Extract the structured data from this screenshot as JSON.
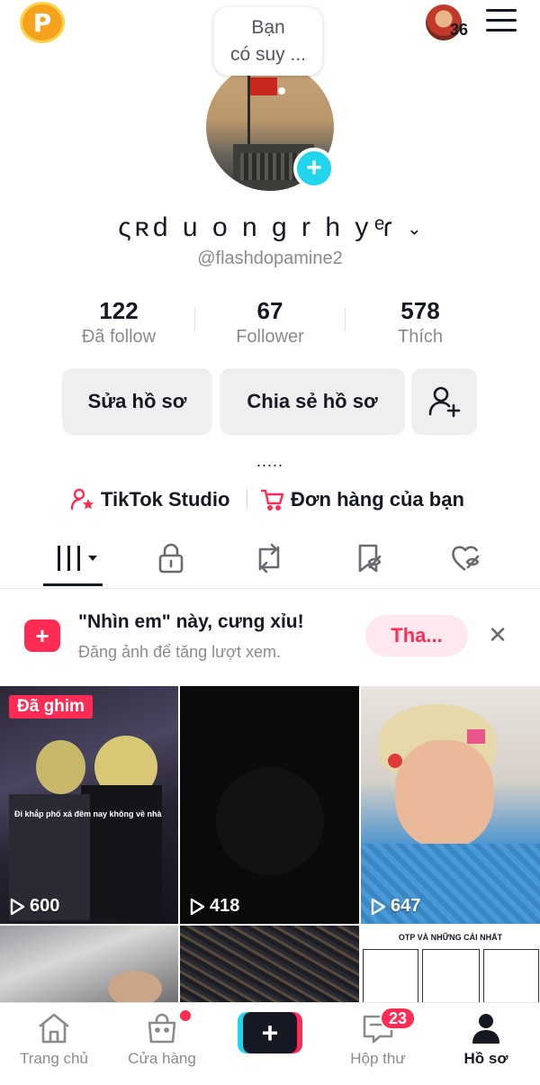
{
  "top_bar": {
    "points_badge": "P",
    "friend_count": "36"
  },
  "profile": {
    "note_bubble_line1": "Bạn",
    "note_bubble_line2": "có suy ...",
    "display_name": "ςʀd u o n g r h y ͤɾ",
    "username": "@flashdopamine2"
  },
  "stats": [
    {
      "value": "122",
      "label": "Đã follow"
    },
    {
      "value": "67",
      "label": "Follower"
    },
    {
      "value": "578",
      "label": "Thích"
    }
  ],
  "actions": {
    "edit_profile": "Sửa hồ sơ",
    "share_profile": "Chia sẻ hồ sơ"
  },
  "bio_placeholder": ".....",
  "shortcuts": {
    "studio": "TikTok Studio",
    "orders": "Đơn hàng của bạn"
  },
  "promo": {
    "title": "\"Nhìn em\" này, cưng xỉu!",
    "subtitle": "Đăng ảnh để tăng lượt xem.",
    "button": "Tha..."
  },
  "videos": [
    {
      "views": "600",
      "pinned_label": "Đã ghim",
      "caption": "Đi khắp phố xá đêm nay không về nhà"
    },
    {
      "views": "418"
    },
    {
      "views": "647"
    },
    {
      "views": ""
    },
    {
      "views": ""
    },
    {
      "title": "OTP VÀ NHỮNG CÁI NHẤT"
    }
  ],
  "bottom_nav": {
    "home": "Trang chủ",
    "shop": "Cửa hàng",
    "inbox": "Hộp thư",
    "inbox_badge": "23",
    "profile": "Hồ sơ"
  },
  "colors": {
    "accent": "#fe2c55",
    "cyan": "#20d5ec",
    "text": "#161823",
    "muted": "#8a8b91"
  }
}
